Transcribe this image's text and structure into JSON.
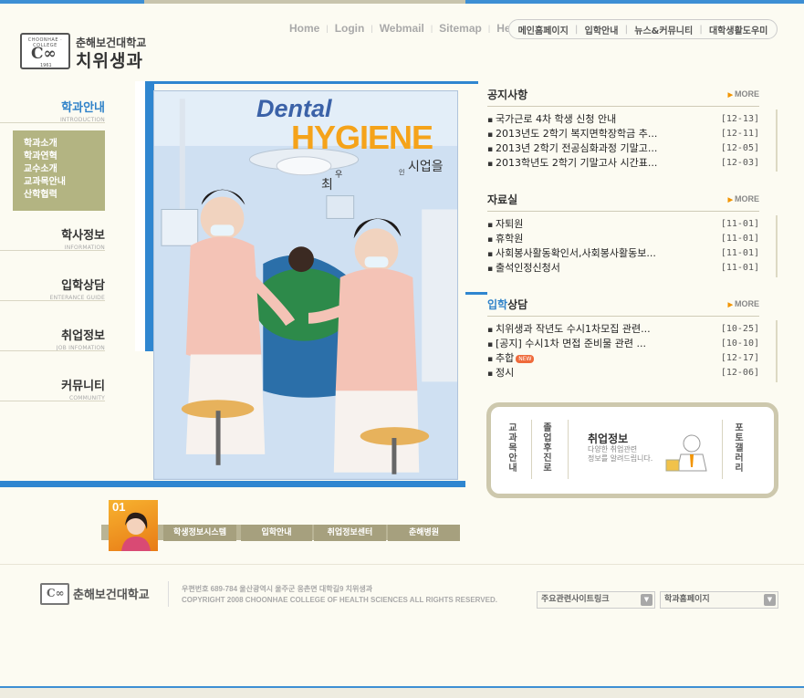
{
  "logo": {
    "arc_text": "CHOONHAE · COLLEGE",
    "symbol": "C∞",
    "year": "1961",
    "school": "춘해보건대학교",
    "dept": "치위생과"
  },
  "util_links": [
    "Home",
    "Login",
    "Webmail",
    "Sitemap",
    "Help"
  ],
  "global_nav": [
    "메인홈페이지",
    "입학안내",
    "뉴스&커뮤니티",
    "대학생활도우미"
  ],
  "left_nav": [
    {
      "label": "학과안내",
      "sub": "INTRODUCTION"
    },
    {
      "label": "학사정보",
      "sub": "INFORMATION"
    },
    {
      "label": "입학상담",
      "sub": "ENTERANCE GUIDE"
    },
    {
      "label": "취업정보",
      "sub": "JOB INFOMATION"
    },
    {
      "label": "커뮤니티",
      "sub": "COMMUNITY"
    }
  ],
  "left_sub": [
    "학과소개",
    "학과연혁",
    "교수소개",
    "교과목안내",
    "산학협력"
  ],
  "visual": {
    "line1": "Dental",
    "line2": "HYGIENE",
    "tag_a": "최",
    "tag_b": "우",
    "tag_c": "인",
    "tag_d": "시업을"
  },
  "boards": [
    {
      "title_hl": "",
      "title": "공지사항",
      "more": "MORE",
      "items": [
        {
          "text": "국가근로 4차 학생 신청 안내",
          "date": "[12-13]"
        },
        {
          "text": "2013년도 2학기 복지면학장학금 추...",
          "date": "[12-11]"
        },
        {
          "text": "2013년 2학기 전공심화과정 기말고...",
          "date": "[12-05]"
        },
        {
          "text": "2013학년도 2학기 기말고사 시간표...",
          "date": "[12-03]"
        }
      ]
    },
    {
      "title_hl": "",
      "title": "자료실",
      "more": "MORE",
      "items": [
        {
          "text": "자퇴원",
          "date": "[11-01]"
        },
        {
          "text": "휴학원",
          "date": "[11-01]"
        },
        {
          "text": "사회봉사활동확인서,사회봉사활동보...",
          "date": "[11-01]"
        },
        {
          "text": "출석인정신청서",
          "date": "[11-01]"
        }
      ]
    },
    {
      "title_hl": "입학",
      "title": "상담",
      "more": "MORE",
      "items": [
        {
          "text": "치위생과 작년도 수시1차모집 관련...",
          "date": "[10-25]"
        },
        {
          "text": "[공지] 수시1차 면접 준비물 관련 ...",
          "date": "[10-10]"
        },
        {
          "text": "추합",
          "date": "[12-17]",
          "badge": "NEW"
        },
        {
          "text": "정시",
          "date": "[12-06]"
        }
      ]
    }
  ],
  "quick": {
    "a": "교과목안내",
    "b": "졸업후진로",
    "job_title": "취업정보",
    "job_desc1": "다양한 취업관련",
    "job_desc2": "정보를 알려드립니다.",
    "c": "포토갤러리"
  },
  "banners": {
    "num": "01",
    "items": [
      "학생정보시스템",
      "입학안내",
      "취업정보센터",
      "춘해병원"
    ]
  },
  "footer": {
    "symbol": "C∞",
    "school": "춘해보건대학교",
    "addr": "우편번호 689-784 울산광역시 울주군 웅촌면 대학길9 치위생과",
    "copyright": "COPYRIGHT 2008  CHOONHAE COLLEGE OF HEALTH SCIENCES ALL RIGHTS RESERVED.",
    "select1": "주요관련사이트링크",
    "select2": "학과홈페이지"
  }
}
